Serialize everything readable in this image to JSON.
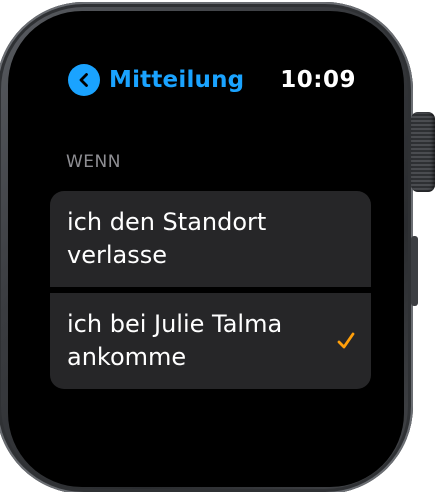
{
  "header": {
    "back_label": "Mitteilung",
    "time": "10:09"
  },
  "section": {
    "label": "WENN"
  },
  "options": [
    {
      "label": "ich den Standort verlasse",
      "selected": false
    },
    {
      "label": "ich bei Julie Talma ankomme",
      "selected": true
    }
  ],
  "colors": {
    "accent": "#1aa3ff",
    "check": "#ff9f0a",
    "row_background": "#262628",
    "section_label": "#8e8e93"
  },
  "icons": {
    "back": "chevron-left-icon",
    "selected": "checkmark-icon"
  }
}
